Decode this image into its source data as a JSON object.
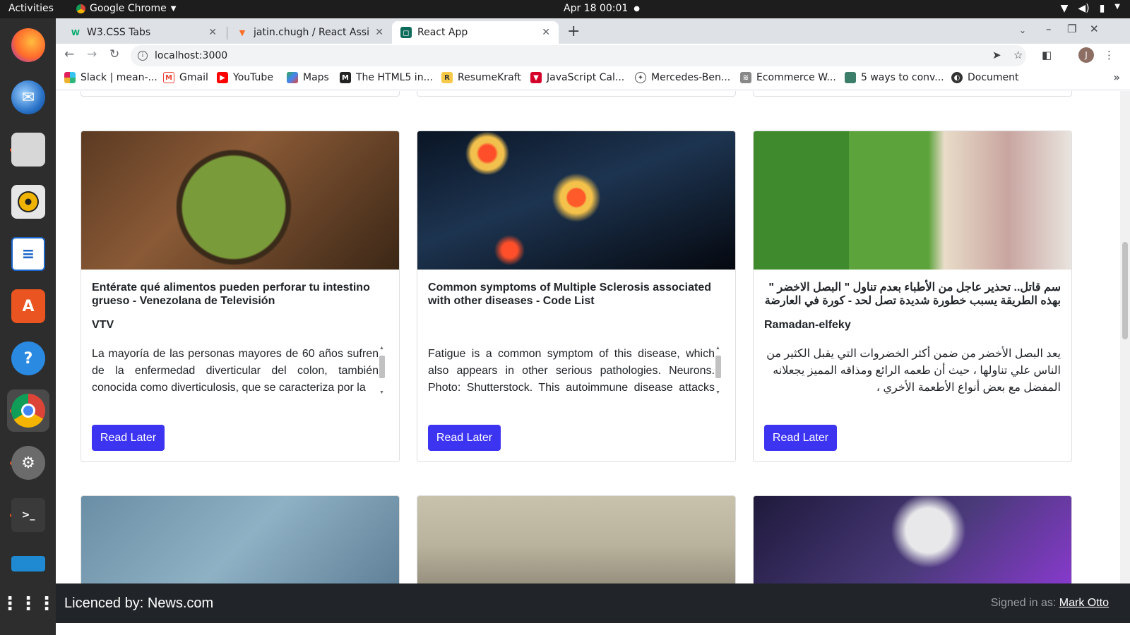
{
  "system": {
    "activities": "Activities",
    "app_name": "Google Chrome",
    "clock": "Apr 18  00:01"
  },
  "tabs": [
    {
      "label": "W3.CSS Tabs",
      "active": false
    },
    {
      "label": "jatin.chugh / React Assign",
      "active": false
    },
    {
      "label": "React App",
      "active": true
    }
  ],
  "address": {
    "url": "localhost:3000"
  },
  "profile": {
    "initial": "J"
  },
  "bookmarks": [
    {
      "label": "Slack | mean-...",
      "icon": "slack-icon"
    },
    {
      "label": "Gmail",
      "icon": "gmail-icon"
    },
    {
      "label": "YouTube",
      "icon": "youtube-icon"
    },
    {
      "label": "Maps",
      "icon": "maps-icon"
    },
    {
      "label": "The HTML5 in...",
      "icon": "html5-icon"
    },
    {
      "label": "ResumeKraft",
      "icon": "resumekraft-icon"
    },
    {
      "label": "JavaScript Cal...",
      "icon": "javascript-icon"
    },
    {
      "label": "Mercedes-Ben...",
      "icon": "mercedes-icon"
    },
    {
      "label": "Ecommerce W...",
      "icon": "ecommerce-icon"
    },
    {
      "label": "5 ways to conv...",
      "icon": "article-icon"
    },
    {
      "label": "Document",
      "icon": "globe-icon"
    }
  ],
  "cards": [
    {
      "title": "Entérate qué alimentos pueden perforar tu intestino grueso - Venezolana de Televisión",
      "source": "VTV",
      "description": "La mayoría de las personas mayores de 60 años sufren de la enfermedad diverticular del colon, también conocida como diverticulosis, que se caracteriza por la",
      "button": "Read Later"
    },
    {
      "title": "Common symptoms of Multiple Sclerosis associated with other diseases - Code List",
      "source": "",
      "description": "Fatigue is a common symptom of this disease, which also appears in other serious pathologies. Neurons. Photo: Shutterstock. This autoimmune disease attacks nerve",
      "button": "Read Later"
    },
    {
      "title": "سم قاتل.. تحذير عاجل من الأطباء بعدم تناول \" البصل الاخضر \" بهذه الطريقة يسبب خطورة شديدة تصل لحد - كورة في العارضة",
      "source": "Ramadan-elfeky",
      "description": "يعد البصل الأخضر من ضمن أكثر الخضروات التي يقبل الكثير من الناس علي تناولها ، حيث أن طعمه الرائع ومذاقه المميز يجعلانه المفضل مع بعض أنواع الأطعمة الأخري ،",
      "button": "Read Later"
    }
  ],
  "footer": {
    "licence": "Licenced by: News.com",
    "signed_in_label": "Signed in as:",
    "user": "Mark Otto"
  }
}
